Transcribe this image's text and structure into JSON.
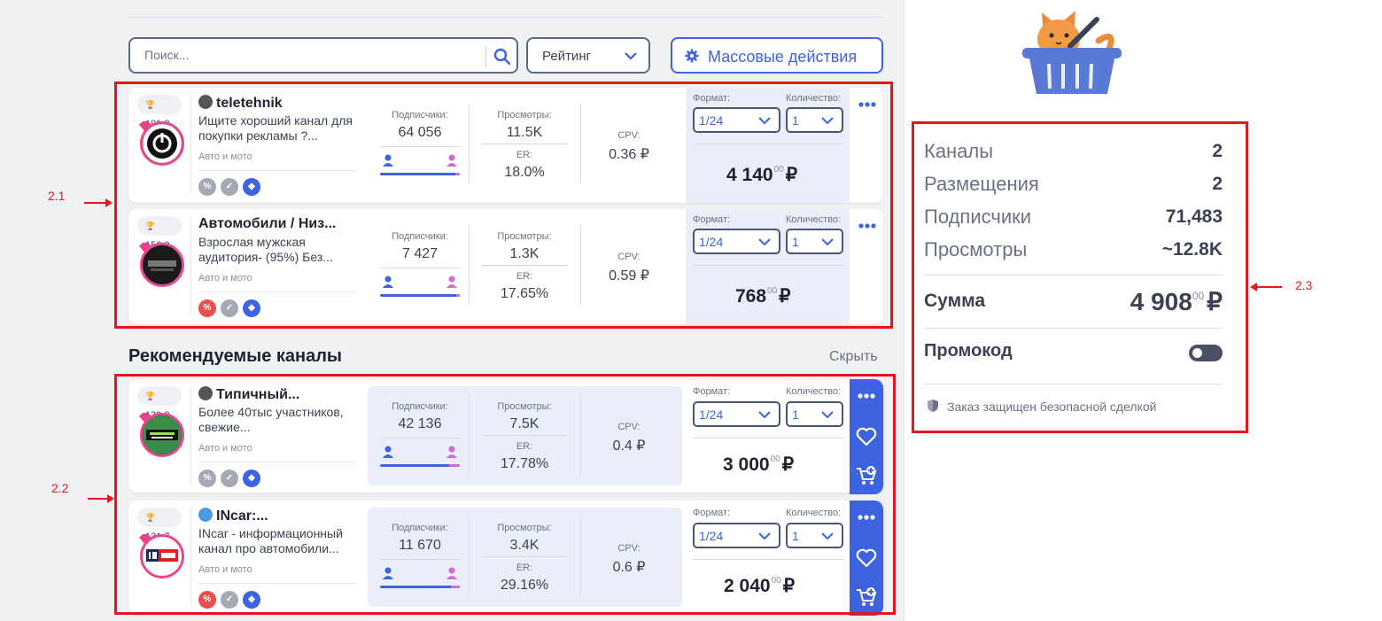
{
  "toolbar": {
    "search_placeholder": "Поиск...",
    "sort_label": "Рейтинг",
    "mass_actions_label": "Массовые действия"
  },
  "labels": {
    "subscribers": "Подписчики:",
    "views": "Просмотры:",
    "er": "ER:",
    "cpv": "CPV:",
    "format": "Формат:",
    "quantity": "Количество:"
  },
  "cart_channels": [
    {
      "rating": "191.3",
      "title": "teletehnik",
      "description": "Ищите хороший канал для покупки рекламы ?...",
      "category": "Авто и мото",
      "subscribers": "64 056",
      "views": "11.5K",
      "er": "18.0%",
      "cpv": "0.36 ₽",
      "format": "1/24",
      "quantity": "1",
      "price_main": "4 140",
      "price_cents": "00",
      "currency": "₽"
    },
    {
      "rating": "156.0",
      "title": "Автомобили / Низ...",
      "description": "Взрослая мужская аудитория- (95%) Без...",
      "category": "Авто и мото",
      "subscribers": "7 427",
      "views": "1.3K",
      "er": "17.65%",
      "cpv": "0.59 ₽",
      "format": "1/24",
      "quantity": "1",
      "price_main": "768",
      "price_cents": "00",
      "currency": "₽"
    }
  ],
  "recommended": {
    "title": "Рекомендуемые каналы",
    "hide_label": "Скрыть",
    "channels": [
      {
        "rating": "139.8",
        "title": "Типичный...",
        "description": "Более 40тыс участников, свежие...",
        "category": "Авто и мото",
        "subscribers": "42 136",
        "views": "7.5K",
        "er": "17.78%",
        "cpv": "0.4 ₽",
        "format": "1/24",
        "quantity": "1",
        "price_main": "3 000",
        "price_cents": "00",
        "currency": "₽"
      },
      {
        "rating": "131.7",
        "title": "INcar:...",
        "description": "INcar - информационный канал про автомобили...",
        "category": "Авто и мото",
        "subscribers": "11 670",
        "views": "3.4K",
        "er": "29.16%",
        "cpv": "0.6 ₽",
        "format": "1/24",
        "quantity": "1",
        "price_main": "2 040",
        "price_cents": "00",
        "currency": "₽"
      }
    ]
  },
  "summary": {
    "channels_label": "Каналы",
    "channels_value": "2",
    "placements_label": "Размещения",
    "placements_value": "2",
    "subscribers_label": "Подписчики",
    "subscribers_value": "71,483",
    "views_label": "Просмотры",
    "views_value": "~12.8K",
    "sum_label": "Сумма",
    "sum_main": "4 908",
    "sum_cents": "00",
    "currency": "₽",
    "promo_label": "Промокод",
    "secure_note": "Заказ защищен безопасной сделкой"
  },
  "annotations": {
    "a1": "2.1",
    "a2": "2.2",
    "a3": "2.3"
  },
  "colors": {
    "accent": "#3d63e0",
    "highlight_box": "#e8161b",
    "pink": "#d46bd0"
  }
}
